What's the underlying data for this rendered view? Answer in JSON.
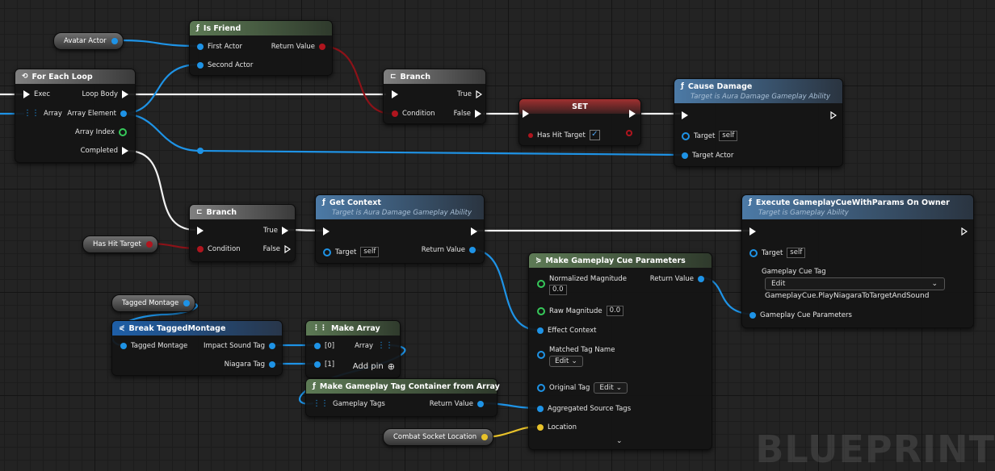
{
  "watermark": "BLUEPRINT",
  "vars": {
    "avatar_actor": "Avatar Actor",
    "has_hit_target": "Has Hit Target",
    "tagged_montage": "Tagged Montage",
    "combat_socket_location": "Combat Socket Location"
  },
  "is_friend": {
    "title": "Is Friend",
    "first_actor": "First Actor",
    "second_actor": "Second Actor",
    "return_value": "Return Value"
  },
  "for_each": {
    "title": "For Each Loop",
    "exec": "Exec",
    "array": "Array",
    "loop_body": "Loop Body",
    "array_element": "Array Element",
    "array_index": "Array Index",
    "completed": "Completed"
  },
  "branch1": {
    "title": "Branch",
    "condition": "Condition",
    "true": "True",
    "false": "False"
  },
  "set_node": {
    "title": "SET",
    "has_hit_target": "Has Hit Target",
    "checked": "✓"
  },
  "cause_damage": {
    "title": "Cause Damage",
    "subtitle": "Target is Aura Damage Gameplay Ability",
    "target": "Target",
    "self": "self",
    "target_actor": "Target Actor"
  },
  "branch2": {
    "title": "Branch",
    "condition": "Condition",
    "true": "True",
    "false": "False"
  },
  "get_context": {
    "title": "Get Context",
    "subtitle": "Target is Aura Damage Gameplay Ability",
    "target": "Target",
    "self": "self",
    "return_value": "Return Value"
  },
  "execute_cue": {
    "title": "Execute GameplayCueWithParams On Owner",
    "subtitle": "Target is Gameplay Ability",
    "target": "Target",
    "self": "self",
    "cue_tag_label": "Gameplay Cue Tag",
    "edit": "Edit",
    "cue_tag_value": "GameplayCue.PlayNiagaraToTargetAndSound",
    "cue_params": "Gameplay Cue Parameters"
  },
  "make_cue_params": {
    "title": "Make Gameplay Cue Parameters",
    "normalized_magnitude": "Normalized Magnitude",
    "normalized_value": "0.0",
    "return_value": "Return Value",
    "raw_magnitude": "Raw Magnitude",
    "raw_value": "0.0",
    "effect_context": "Effect Context",
    "matched_tag_name": "Matched Tag Name",
    "edit": "Edit",
    "original_tag": "Original Tag",
    "aggregated_source_tags": "Aggregated Source Tags",
    "location": "Location"
  },
  "break_montage": {
    "title": "Break TaggedMontage",
    "tagged_montage": "Tagged Montage",
    "impact_sound_tag": "Impact Sound Tag",
    "niagara_tag": "Niagara Tag"
  },
  "make_array": {
    "title": "Make Array",
    "in0": "[0]",
    "in1": "[1]",
    "array": "Array",
    "add_pin": "Add pin"
  },
  "make_tag_container": {
    "title": "Make Gameplay Tag Container from Array",
    "gameplay_tags": "Gameplay Tags",
    "return_value": "Return Value"
  },
  "colors": {
    "exec": "#ffffff",
    "object": "#1e93e6",
    "bool": "#b0151e",
    "int": "#36c95a",
    "vector": "#e8c22a"
  }
}
